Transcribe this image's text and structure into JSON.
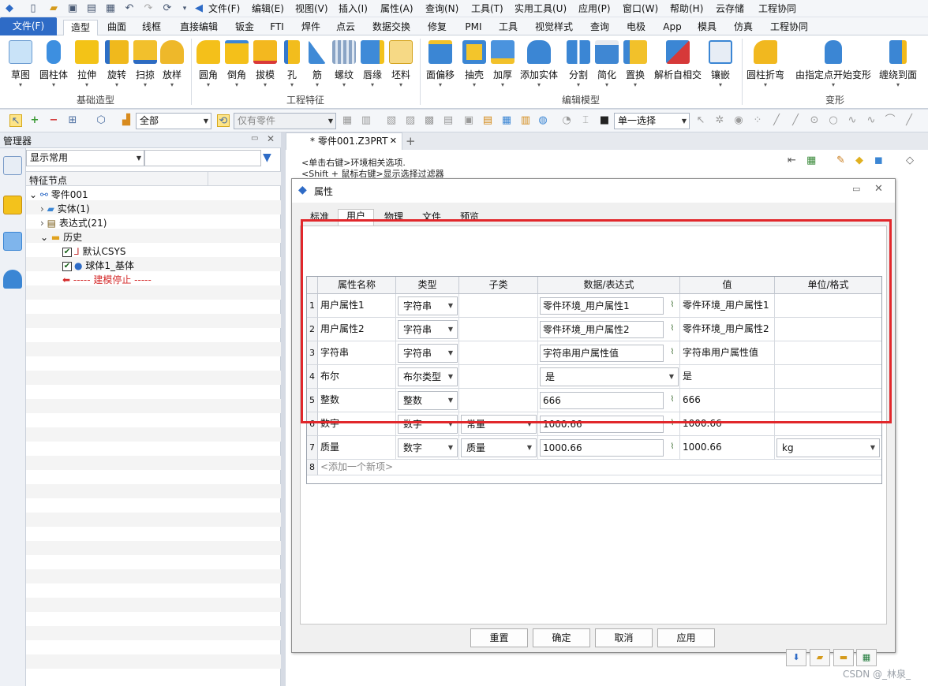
{
  "menubar": {
    "items": [
      "文件(F)",
      "编辑(E)",
      "视图(V)",
      "插入(I)",
      "属性(A)",
      "查询(N)",
      "工具(T)",
      "实用工具(U)",
      "应用(P)",
      "窗口(W)",
      "帮助(H)",
      "云存储",
      "工程协同"
    ]
  },
  "ribbon_tabs": [
    "文件(F)",
    "造型",
    "曲面",
    "线框",
    "直接编辑",
    "钣金",
    "FTI",
    "焊件",
    "点云",
    "数据交换",
    "修复",
    "PMI",
    "工具",
    "视觉样式",
    "查询",
    "电极",
    "App",
    "模具",
    "仿真",
    "工程协同"
  ],
  "ribbon": {
    "groups": [
      "基础造型",
      "工程特征",
      "编辑模型",
      "变形"
    ],
    "buttons": [
      "草图",
      "圆柱体",
      "拉伸",
      "旋转",
      "扫掠",
      "放样",
      "圆角",
      "倒角",
      "拔模",
      "孔",
      "筋",
      "螺纹",
      "唇缘",
      "坯料",
      "面偏移",
      "抽壳",
      "加厚",
      "添加实体",
      "分割",
      "简化",
      "置换",
      "解析自相交",
      "镶嵌",
      "圆柱折弯",
      "由指定点开始变形",
      "缠绕到面"
    ]
  },
  "toolbar2": {
    "filter_value": "全部",
    "scope_placeholder": "仅有零件",
    "select_mode": "单一选择"
  },
  "manager": {
    "title": "管理器",
    "display_combo": "显示常用",
    "column_header": "特征节点",
    "tree": {
      "root": "零件001",
      "solid": "实体(1)",
      "expr": "表达式(21)",
      "history": "历史",
      "csys": "默认CSYS",
      "body": "球体1_基体",
      "stop": "----- 建模停止 -----"
    }
  },
  "document": {
    "tab_title": "* 零件001.Z3PRT",
    "add_tab": "+",
    "hint1": "<单击右键>环境相关选项.",
    "hint2": "<Shift + 鼠标右键>显示选择过滤器"
  },
  "dialog": {
    "title": "属性",
    "tabs": [
      "标准",
      "用户",
      "物理",
      "文件",
      "预览"
    ],
    "active_tab": "用户",
    "columns": [
      "属性名称",
      "类型",
      "子类",
      "数据/表达式",
      "值",
      "单位/格式"
    ],
    "rows": [
      {
        "n": "1",
        "name": "用户属性1",
        "type": "字符串",
        "sub": "",
        "data": "零件环境_用户属性1",
        "value": "零件环境_用户属性1",
        "unit": ""
      },
      {
        "n": "2",
        "name": "用户属性2",
        "type": "字符串",
        "sub": "",
        "data": "零件环境_用户属性2",
        "value": "零件环境_用户属性2",
        "unit": ""
      },
      {
        "n": "3",
        "name": "字符串",
        "type": "字符串",
        "sub": "",
        "data": "字符串用户属性值",
        "value": "字符串用户属性值",
        "unit": ""
      },
      {
        "n": "4",
        "name": "布尔",
        "type": "布尔类型",
        "sub": "",
        "data": "是",
        "value": "是",
        "unit": ""
      },
      {
        "n": "5",
        "name": "整数",
        "type": "整数",
        "sub": "",
        "data": "666",
        "value": "666",
        "unit": ""
      },
      {
        "n": "6",
        "name": "数字",
        "type": "数字",
        "sub": "常量",
        "data": "1000.66",
        "value": "1000.66",
        "unit": ""
      },
      {
        "n": "7",
        "name": "质量",
        "type": "数字",
        "sub": "质量",
        "data": "1000.66",
        "value": "1000.66",
        "unit": "kg"
      }
    ],
    "new_row": {
      "n": "8",
      "text": "<添加一个新项>"
    },
    "buttons": {
      "reset": "重置",
      "ok": "确定",
      "cancel": "取消",
      "apply": "应用"
    }
  },
  "watermark": "CSDN @_林泉_",
  "colors": {
    "accent": "#2e6bc6",
    "highlight": "#e1272b"
  }
}
